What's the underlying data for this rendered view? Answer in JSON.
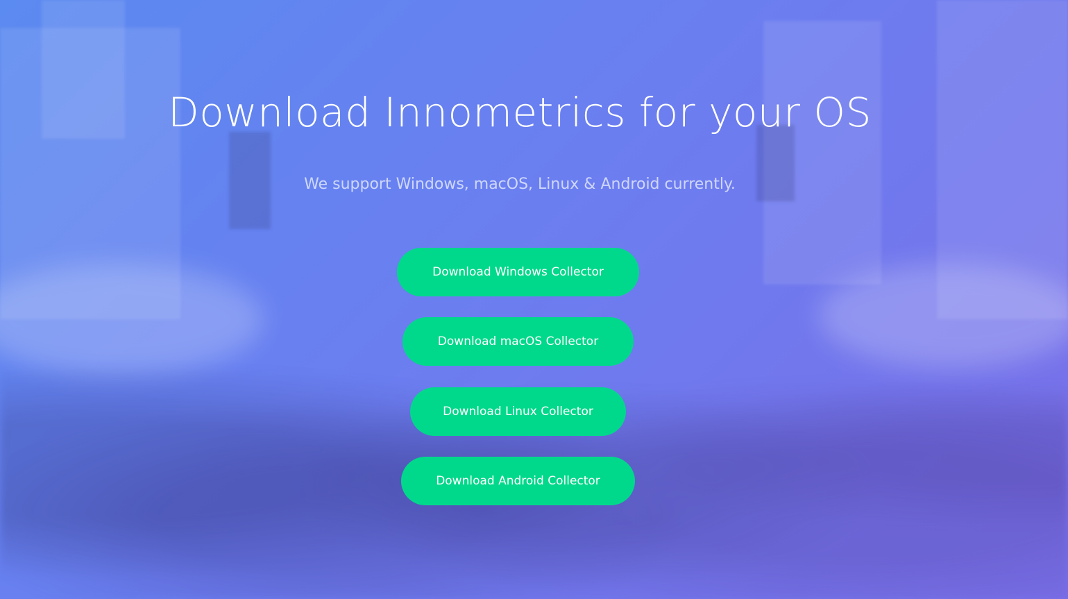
{
  "page": {
    "title": "Download Innometrics for your OS",
    "subtitle": "We support Windows, macOS, Linux & Android currently."
  },
  "downloads": [
    {
      "label": "Download Windows Collector"
    },
    {
      "label": "Download macOS Collector"
    },
    {
      "label": "Download Linux Collector"
    },
    {
      "label": "Download Android Collector"
    }
  ],
  "colors": {
    "background_start": "#5b8af0",
    "background_end": "#7a6fe8",
    "button": "#00d98b",
    "text": "#ffffff"
  }
}
